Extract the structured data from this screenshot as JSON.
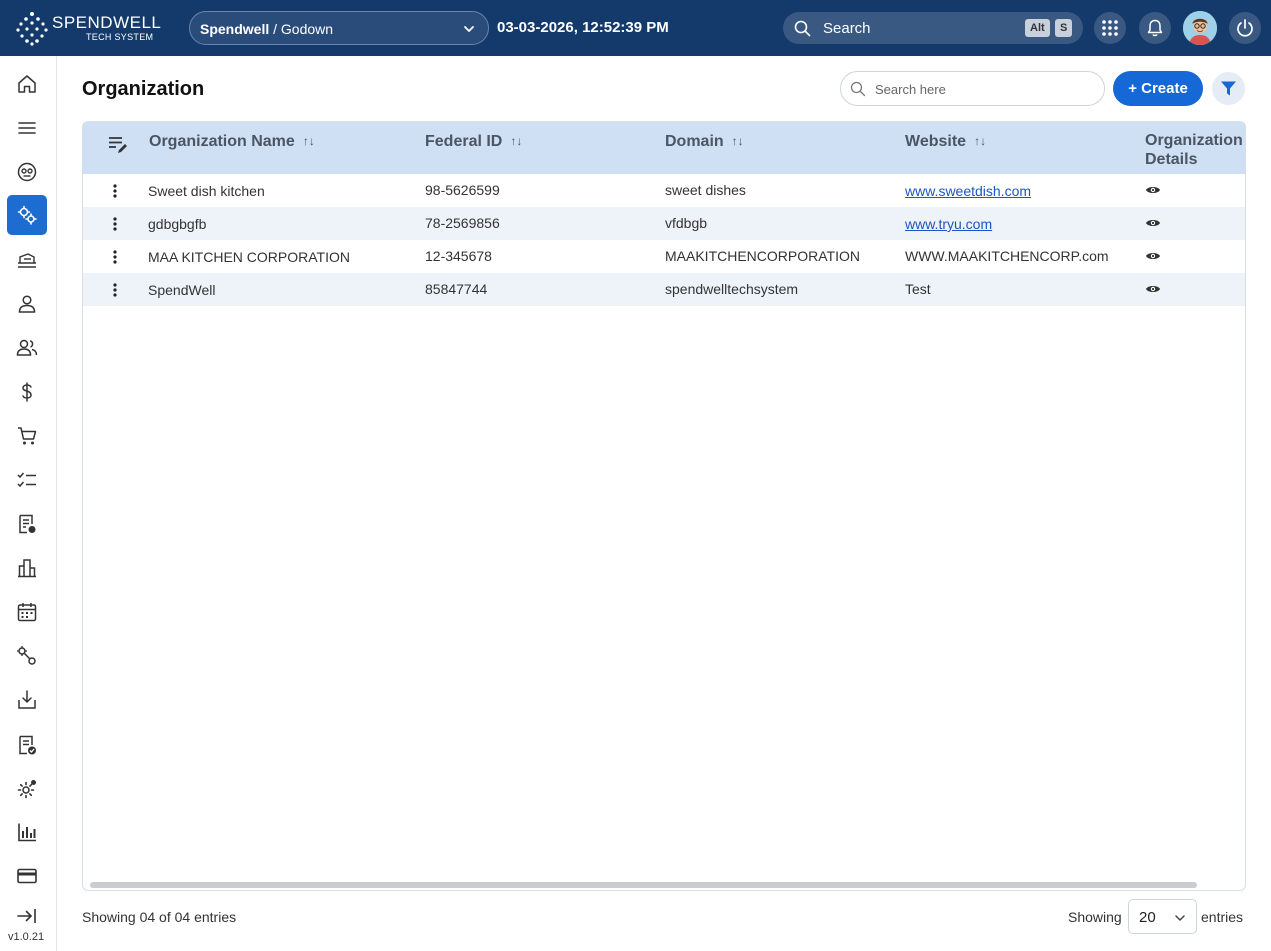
{
  "header": {
    "logo_name": "SPENDWELL",
    "logo_sub": "TECH SYSTEM",
    "org_path_bold": "Spendwell",
    "org_path_rest": " / Godown",
    "datetime": "03-03-2026, 12:52:39 PM",
    "search_label": "Search",
    "shortcut_alt": "Alt",
    "shortcut_s": "S"
  },
  "sidebar": {
    "items": [
      {
        "icon": "home-icon"
      },
      {
        "icon": "menu-icon"
      },
      {
        "icon": "dashboard-face-icon"
      },
      {
        "icon": "settings-gears-icon",
        "active": true
      },
      {
        "icon": "truck-icon"
      },
      {
        "icon": "user-icon"
      },
      {
        "icon": "users-icon"
      },
      {
        "icon": "dollar-icon"
      },
      {
        "icon": "cart-icon"
      },
      {
        "icon": "checklist-icon"
      },
      {
        "icon": "invoice-icon"
      },
      {
        "icon": "buildings-icon"
      },
      {
        "icon": "calendar-icon"
      },
      {
        "icon": "workflow-icon"
      },
      {
        "icon": "download-tray-icon"
      },
      {
        "icon": "approved-doc-icon"
      },
      {
        "icon": "gear-badge-icon"
      },
      {
        "icon": "bar-chart-icon"
      },
      {
        "icon": "card-icon"
      },
      {
        "icon": "logout-arrow-icon"
      }
    ],
    "version": "v1.0.21"
  },
  "page": {
    "title": "Organization",
    "search_placeholder": "Search here",
    "create_label": "+ Create"
  },
  "table": {
    "columns": [
      "Organization Name",
      "Federal ID",
      "Domain",
      "Website",
      "Organization",
      "Details"
    ],
    "rows": [
      {
        "name": "Sweet dish kitchen",
        "federal_id": "98-5626599",
        "domain": "sweet dishes",
        "website": "www.sweetdish.com",
        "website_link": true
      },
      {
        "name": "gdbgbgfb",
        "federal_id": "78-2569856",
        "domain": "vfdbgb",
        "website": "www.tryu.com",
        "website_link": true
      },
      {
        "name": "MAA KITCHEN CORPORATION",
        "federal_id": "12-345678",
        "domain": "MAAKITCHENCORPORATION",
        "website": "WWW.MAAKITCHENCORP.com",
        "website_link": false
      },
      {
        "name": "SpendWell",
        "federal_id": "85847744",
        "domain": "spendwelltechsystem",
        "website": "Test",
        "website_link": false
      }
    ]
  },
  "footer": {
    "summary": "Showing 04 of 04 entries",
    "showing_label": "Showing",
    "page_size": "20",
    "entries_label": "entries"
  },
  "colors": {
    "topbar": "#143a6b",
    "accent": "#1668d6",
    "table_header": "#cfe0f5",
    "row_alt": "#eef3fa"
  }
}
